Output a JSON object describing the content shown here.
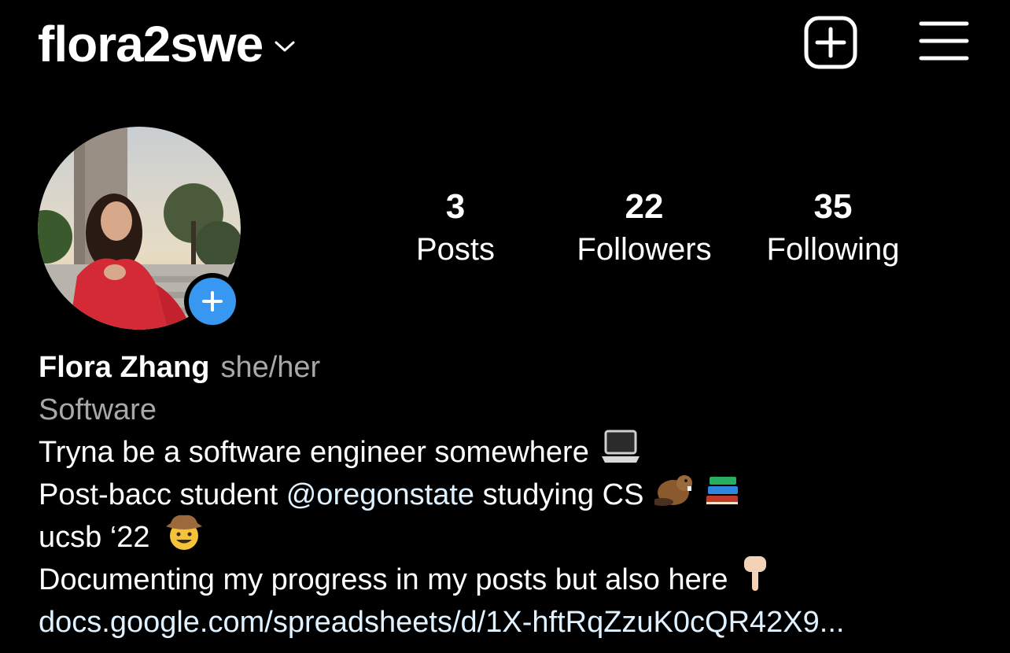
{
  "header": {
    "username": "flora2swe",
    "username_chevron_icon": "chevron-down-icon",
    "create_icon": "plus-square-icon",
    "menu_icon": "hamburger-menu-icon"
  },
  "profile": {
    "avatar_icon": "profile-photo",
    "add_story_icon": "plus-circle-icon",
    "stats": [
      {
        "count": "3",
        "label": "Posts"
      },
      {
        "count": "22",
        "label": "Followers"
      },
      {
        "count": "35",
        "label": "Following"
      }
    ]
  },
  "bio": {
    "name": "Flora Zhang",
    "pronouns": "she/her",
    "category": "Software",
    "line1": "Tryna be a software engineer somewhere",
    "line2_prefix": "Post-bacc student ",
    "line2_mention": "@oregonstate",
    "line2_suffix": " studying CS",
    "line3": "ucsb ‘22",
    "line4": "Documenting my progress in my posts but also here",
    "link": "docs.google.com/spreadsheets/d/1X-hftRqZzuK0cQR42X9...",
    "emojis": [
      "laptop-emoji",
      "beaver-emoji",
      "books-emoji",
      "cowboy-emoji",
      "pointing-down-emoji"
    ]
  },
  "colors": {
    "background": "#000000",
    "text": "#ffffff",
    "secondary_text": "#a8a8a8",
    "link_text": "#e0f1ff",
    "accent_blue": "#3897f0"
  }
}
